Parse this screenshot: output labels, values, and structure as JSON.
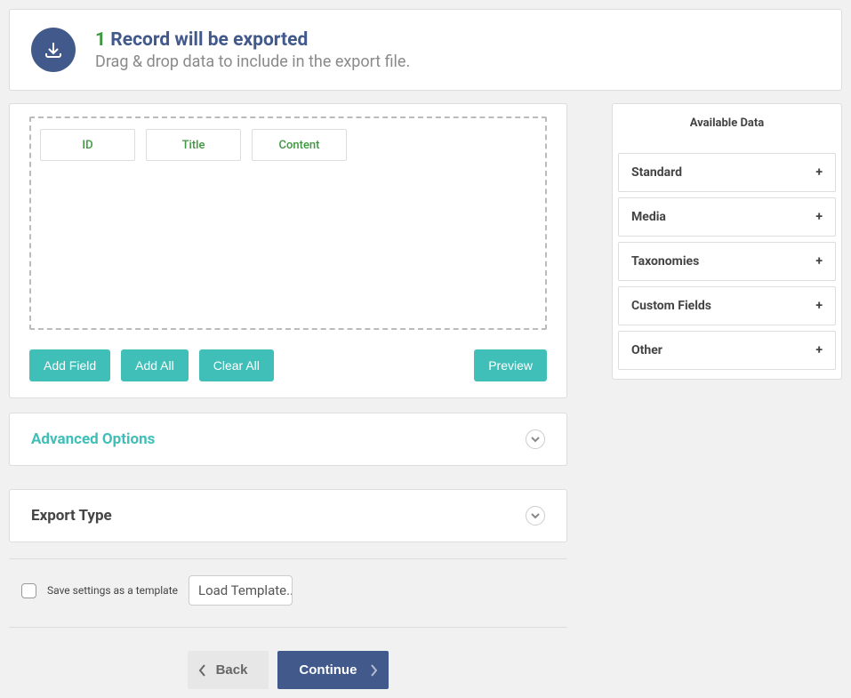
{
  "header": {
    "count": "1",
    "title_rest": "Record will be exported",
    "subtitle": "Drag & drop data to include in the export file."
  },
  "drop_fields": [
    "ID",
    "Title",
    "Content"
  ],
  "buttons": {
    "add_field": "Add Field",
    "add_all": "Add All",
    "clear_all": "Clear All",
    "preview": "Preview",
    "back": "Back",
    "continue": "Continue"
  },
  "accordions": {
    "advanced": "Advanced Options",
    "export_type": "Export Type"
  },
  "available": {
    "heading": "Available Data",
    "items": [
      "Standard",
      "Media",
      "Taxonomies",
      "Custom Fields",
      "Other"
    ]
  },
  "save": {
    "label": "Save settings as a template",
    "select": "Load Template..."
  }
}
